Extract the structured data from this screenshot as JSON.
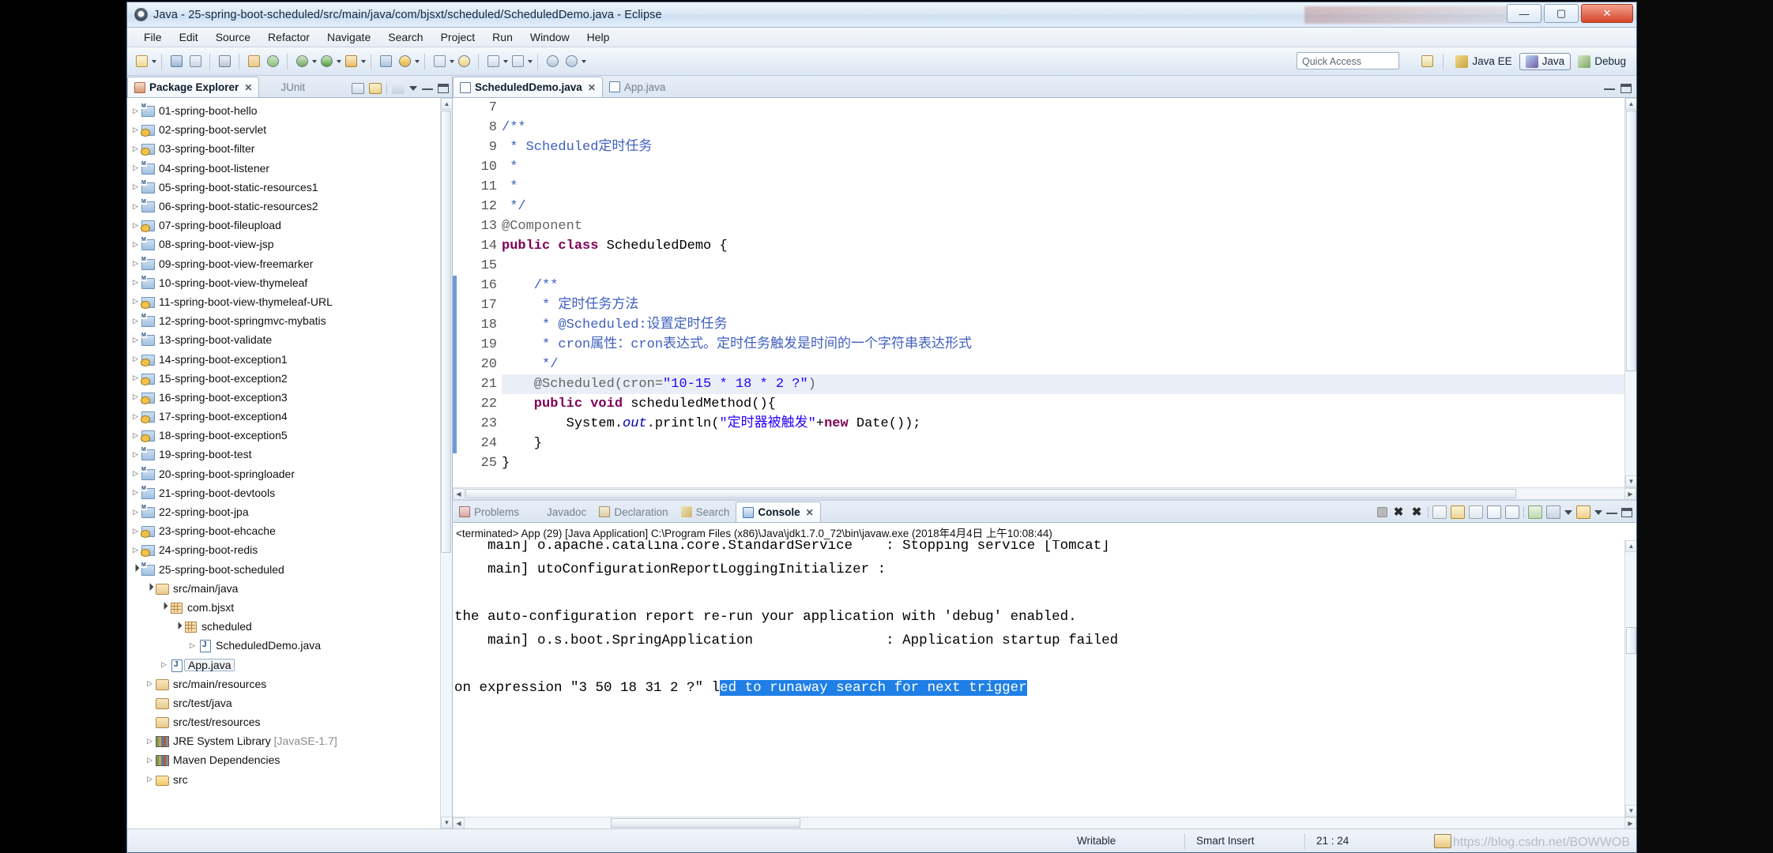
{
  "window": {
    "title": "Java - 25-spring-boot-scheduled/src/main/java/com/bjsxt/scheduled/ScheduledDemo.java - Eclipse",
    "minimize_label": "—",
    "maximize_label": "▢",
    "close_label": "✕"
  },
  "menubar": {
    "items": [
      "File",
      "Edit",
      "Source",
      "Refactor",
      "Navigate",
      "Search",
      "Project",
      "Run",
      "Window",
      "Help"
    ]
  },
  "toolbar": {
    "quick_access_placeholder": "Quick Access",
    "perspectives": [
      {
        "label": "Java EE",
        "active": false
      },
      {
        "label": "Java",
        "active": true
      },
      {
        "label": "Debug",
        "active": false
      }
    ]
  },
  "explorer": {
    "tabs": [
      {
        "label": "Package Explorer",
        "active": true,
        "closable": true
      },
      {
        "label": "JUnit",
        "active": false,
        "closable": false
      }
    ],
    "tree": [
      {
        "label": "01-spring-boot-hello",
        "indent": 0,
        "twisty": "closed",
        "icon": "project-icon",
        "warn": false
      },
      {
        "label": "02-spring-boot-servlet",
        "indent": 0,
        "twisty": "closed",
        "icon": "project-icon",
        "warn": true
      },
      {
        "label": "03-spring-boot-filter",
        "indent": 0,
        "twisty": "closed",
        "icon": "project-icon",
        "warn": true
      },
      {
        "label": "04-spring-boot-listener",
        "indent": 0,
        "twisty": "closed",
        "icon": "project-icon",
        "warn": false
      },
      {
        "label": "05-spring-boot-static-resources1",
        "indent": 0,
        "twisty": "closed",
        "icon": "project-icon",
        "warn": false
      },
      {
        "label": "06-spring-boot-static-resources2",
        "indent": 0,
        "twisty": "closed",
        "icon": "project-icon",
        "warn": false
      },
      {
        "label": "07-spring-boot-fileupload",
        "indent": 0,
        "twisty": "closed",
        "icon": "project-icon",
        "warn": true
      },
      {
        "label": "08-spring-boot-view-jsp",
        "indent": 0,
        "twisty": "closed",
        "icon": "project-icon",
        "warn": false
      },
      {
        "label": "09-spring-boot-view-freemarker",
        "indent": 0,
        "twisty": "closed",
        "icon": "project-icon",
        "warn": false
      },
      {
        "label": "10-spring-boot-view-thymeleaf",
        "indent": 0,
        "twisty": "closed",
        "icon": "project-icon",
        "warn": false
      },
      {
        "label": "11-spring-boot-view-thymeleaf-URL",
        "indent": 0,
        "twisty": "closed",
        "icon": "project-icon",
        "warn": true
      },
      {
        "label": "12-spring-boot-springmvc-mybatis",
        "indent": 0,
        "twisty": "closed",
        "icon": "project-icon",
        "warn": false
      },
      {
        "label": "13-spring-boot-validate",
        "indent": 0,
        "twisty": "closed",
        "icon": "project-icon",
        "warn": false
      },
      {
        "label": "14-spring-boot-exception1",
        "indent": 0,
        "twisty": "closed",
        "icon": "project-icon",
        "warn": true
      },
      {
        "label": "15-spring-boot-exception2",
        "indent": 0,
        "twisty": "closed",
        "icon": "project-icon",
        "warn": true
      },
      {
        "label": "16-spring-boot-exception3",
        "indent": 0,
        "twisty": "closed",
        "icon": "project-icon",
        "warn": true
      },
      {
        "label": "17-spring-boot-exception4",
        "indent": 0,
        "twisty": "closed",
        "icon": "project-icon",
        "warn": true
      },
      {
        "label": "18-spring-boot-exception5",
        "indent": 0,
        "twisty": "closed",
        "icon": "project-icon",
        "warn": true
      },
      {
        "label": "19-spring-boot-test",
        "indent": 0,
        "twisty": "closed",
        "icon": "project-icon",
        "warn": false
      },
      {
        "label": "20-spring-boot-springloader",
        "indent": 0,
        "twisty": "closed",
        "icon": "project-icon",
        "warn": false
      },
      {
        "label": "21-spring-boot-devtools",
        "indent": 0,
        "twisty": "closed",
        "icon": "project-icon",
        "warn": false
      },
      {
        "label": "22-spring-boot-jpa",
        "indent": 0,
        "twisty": "closed",
        "icon": "project-icon",
        "warn": false
      },
      {
        "label": "23-spring-boot-ehcache",
        "indent": 0,
        "twisty": "closed",
        "icon": "project-icon",
        "warn": true
      },
      {
        "label": "24-spring-boot-redis",
        "indent": 0,
        "twisty": "closed",
        "icon": "project-icon",
        "warn": true
      },
      {
        "label": "25-spring-boot-scheduled",
        "indent": 0,
        "twisty": "open",
        "icon": "project-icon",
        "warn": false
      },
      {
        "label": "src/main/java",
        "indent": 1,
        "twisty": "open",
        "icon": "source-folder-icon",
        "warn": false
      },
      {
        "label": "com.bjsxt",
        "indent": 2,
        "twisty": "open",
        "icon": "package-icon",
        "warn": false
      },
      {
        "label": "scheduled",
        "indent": 3,
        "twisty": "open",
        "icon": "package-icon",
        "warn": false
      },
      {
        "label": "ScheduledDemo.java",
        "indent": 4,
        "twisty": "closed",
        "icon": "java-file-icon",
        "warn": false
      },
      {
        "label": "App.java",
        "indent": 2,
        "twisty": "closed",
        "icon": "java-file-icon",
        "warn": false,
        "selected": true
      },
      {
        "label": "src/main/resources",
        "indent": 1,
        "twisty": "closed",
        "icon": "source-folder-icon",
        "warn": false
      },
      {
        "label": "src/test/java",
        "indent": 1,
        "twisty": "none",
        "icon": "source-folder-icon",
        "warn": false
      },
      {
        "label": "src/test/resources",
        "indent": 1,
        "twisty": "none",
        "icon": "source-folder-icon",
        "warn": false
      },
      {
        "label": "JRE System Library",
        "suffix": "[JavaSE-1.7]",
        "indent": 1,
        "twisty": "closed",
        "icon": "library-icon",
        "warn": false
      },
      {
        "label": "Maven Dependencies",
        "indent": 1,
        "twisty": "closed",
        "icon": "library-icon",
        "warn": false
      },
      {
        "label": "src",
        "indent": 1,
        "twisty": "closed",
        "icon": "folder-icon",
        "warn": false
      }
    ]
  },
  "editor": {
    "tabs": [
      {
        "label": "ScheduledDemo.java",
        "active": true,
        "closable": true
      },
      {
        "label": "App.java",
        "active": false,
        "closable": false
      }
    ],
    "lines": [
      {
        "num": "7",
        "fold": false,
        "hl": false,
        "tokens": []
      },
      {
        "num": "8",
        "fold": true,
        "hl": false,
        "tokens": [
          {
            "t": "/**",
            "c": "c"
          }
        ]
      },
      {
        "num": "9",
        "fold": false,
        "hl": false,
        "tokens": [
          {
            "t": " * Scheduled定时任务",
            "c": "c"
          }
        ]
      },
      {
        "num": "10",
        "fold": false,
        "hl": false,
        "tokens": [
          {
            "t": " *",
            "c": "c"
          }
        ]
      },
      {
        "num": "11",
        "fold": false,
        "hl": false,
        "tokens": [
          {
            "t": " *",
            "c": "c"
          }
        ]
      },
      {
        "num": "12",
        "fold": false,
        "hl": false,
        "tokens": [
          {
            "t": " */",
            "c": "c"
          }
        ]
      },
      {
        "num": "13",
        "fold": false,
        "hl": false,
        "tokens": [
          {
            "t": "@Component",
            "c": "an"
          }
        ]
      },
      {
        "num": "14",
        "fold": false,
        "hl": false,
        "tokens": [
          {
            "t": "public class",
            "c": "k"
          },
          {
            "t": " ScheduledDemo {",
            "c": ""
          }
        ]
      },
      {
        "num": "15",
        "fold": false,
        "hl": false,
        "tokens": []
      },
      {
        "num": "16",
        "fold": true,
        "hl": false,
        "tokens": [
          {
            "t": "    /**",
            "c": "c"
          }
        ]
      },
      {
        "num": "17",
        "fold": false,
        "hl": false,
        "tokens": [
          {
            "t": "     * 定时任务方法",
            "c": "c"
          }
        ]
      },
      {
        "num": "18",
        "fold": false,
        "hl": false,
        "tokens": [
          {
            "t": "     * @Scheduled:设置定时任务",
            "c": "c"
          }
        ]
      },
      {
        "num": "19",
        "fold": false,
        "hl": false,
        "tokens": [
          {
            "t": "     * cron属性：cron表达式。定时任务触发是时间的一个字符串表达形式",
            "c": "c"
          }
        ]
      },
      {
        "num": "20",
        "fold": false,
        "hl": false,
        "tokens": [
          {
            "t": "     */",
            "c": "c"
          }
        ]
      },
      {
        "num": "21",
        "fold": true,
        "hl": true,
        "tokens": [
          {
            "t": "    @Scheduled(cron=",
            "c": "an"
          },
          {
            "t": "\"10-15 * 18 * 2 ?\"",
            "c": "s"
          },
          {
            "t": ")",
            "c": "an"
          }
        ]
      },
      {
        "num": "22",
        "fold": false,
        "hl": false,
        "tokens": [
          {
            "t": "    public void",
            "c": "k"
          },
          {
            "t": " scheduledMethod(){",
            "c": ""
          }
        ]
      },
      {
        "num": "23",
        "fold": false,
        "hl": false,
        "tokens": [
          {
            "t": "        System.",
            "c": ""
          },
          {
            "t": "out",
            "c": "f"
          },
          {
            "t": ".println(",
            "c": ""
          },
          {
            "t": "\"定时器被触发\"",
            "c": "s"
          },
          {
            "t": "+",
            "c": ""
          },
          {
            "t": "new",
            "c": "k"
          },
          {
            "t": " Date());",
            "c": ""
          }
        ]
      },
      {
        "num": "24",
        "fold": false,
        "hl": false,
        "tokens": [
          {
            "t": "    }",
            "c": ""
          }
        ]
      },
      {
        "num": "25",
        "fold": false,
        "hl": false,
        "tokens": [
          {
            "t": "}",
            "c": ""
          }
        ]
      }
    ]
  },
  "console": {
    "tabs": [
      {
        "label": "Problems",
        "active": false
      },
      {
        "label": "Javadoc",
        "active": false
      },
      {
        "label": "Declaration",
        "active": false
      },
      {
        "label": "Search",
        "active": false
      },
      {
        "label": "Console",
        "active": true
      }
    ],
    "launch_line": "<terminated> App (29) [Java Application] C:\\Program Files (x86)\\Java\\jdk1.7.0_72\\bin\\javaw.exe (2018年4月4日 上午10:08:44)",
    "output_lines": [
      {
        "pre": "    main] o.apache.catalina.core.StandardService    : Stopping service [Tomcat]",
        "sel": ""
      },
      {
        "pre": "    main] utoConfigurationReportLoggingInitializer :",
        "sel": ""
      },
      {
        "pre": "",
        "sel": ""
      },
      {
        "pre": "the auto-configuration report re-run your application with 'debug' enabled.",
        "sel": ""
      },
      {
        "pre": "    main] o.s.boot.SpringApplication                : Application startup failed",
        "sel": ""
      },
      {
        "pre": "",
        "sel": ""
      },
      {
        "pre": "on expression \"3 50 18 31 2 ?\" l",
        "sel": "ed to runaway search for next trigger"
      }
    ]
  },
  "statusbar": {
    "writable": "Writable",
    "insert_mode": "Smart Insert",
    "position": "21 : 24",
    "watermark": "https://blog.csdn.net/BOWWOB"
  }
}
